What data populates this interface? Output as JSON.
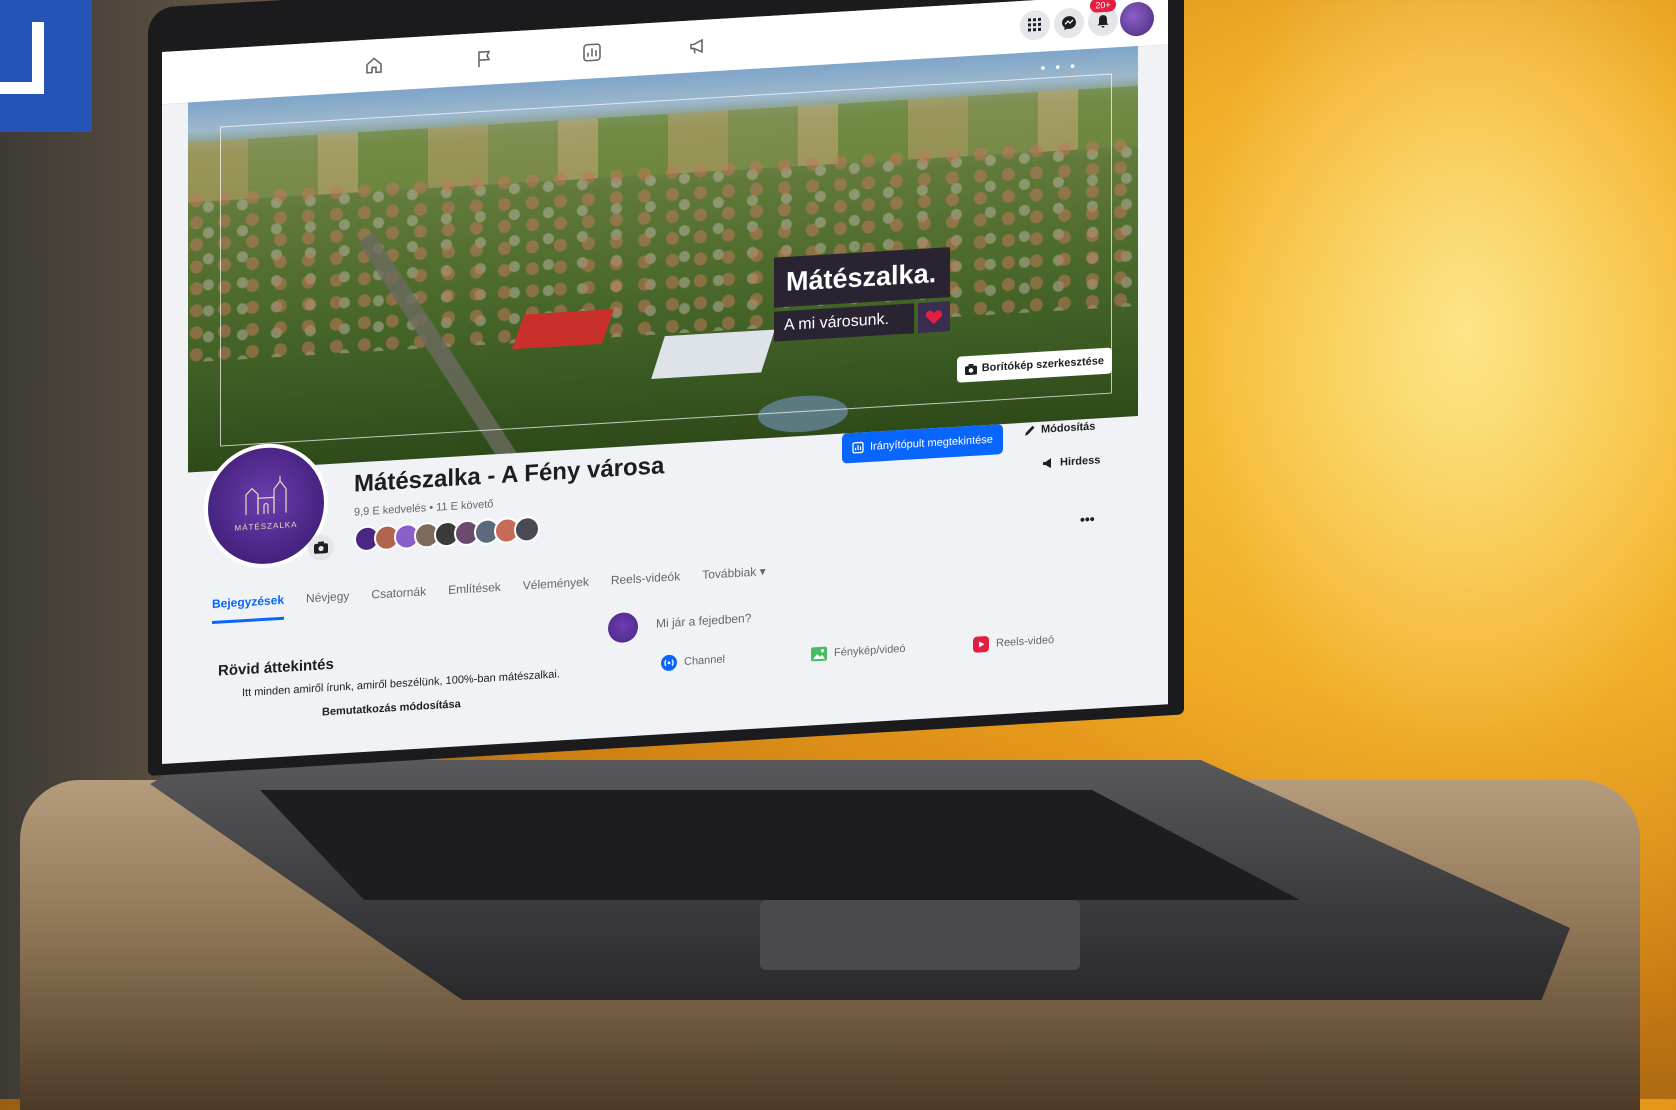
{
  "topnav": {
    "notification_count": "20+",
    "icons": [
      "home-icon",
      "flag-icon",
      "insights-icon",
      "megaphone-icon",
      "grid-menu-icon",
      "messenger-icon",
      "bell-icon"
    ]
  },
  "cover": {
    "brand_title": "Mátészalka.",
    "brand_subtitle": "A mi városunk.",
    "edit_button": "Borítókép szerkesztése"
  },
  "profile": {
    "logo_text": "MÁTÉSZALKA",
    "page_name": "Mátészalka - A Fény városa",
    "stats": "9,9 E kedvelés • 11 E követő"
  },
  "actions": {
    "dashboard": "Irányítópult megtekintése",
    "edit": "Módosítás",
    "advertise": "Hirdess",
    "more": "•••"
  },
  "tabs": [
    {
      "label": "Bejegyzések",
      "active": true
    },
    {
      "label": "Névjegy"
    },
    {
      "label": "Csatornák"
    },
    {
      "label": "Említések"
    },
    {
      "label": "Vélemények"
    },
    {
      "label": "Reels-videók"
    },
    {
      "label": "Továbbiak ▾"
    }
  ],
  "overview": {
    "title": "Rövid áttekintés",
    "text": "Itt minden amiről írunk, amiről beszélünk, 100%-ban mátészalkai.",
    "edit_button": "Bemutatkozás módosítása"
  },
  "composer": {
    "placeholder": "Mi jár a fejedben?",
    "channel": "Channel",
    "photo_video": "Fénykép/videó",
    "reels": "Reels-videó"
  },
  "colors": {
    "accent": "#0866ff",
    "brand_purple": "#4b2685",
    "heart": "#e41e3f"
  }
}
